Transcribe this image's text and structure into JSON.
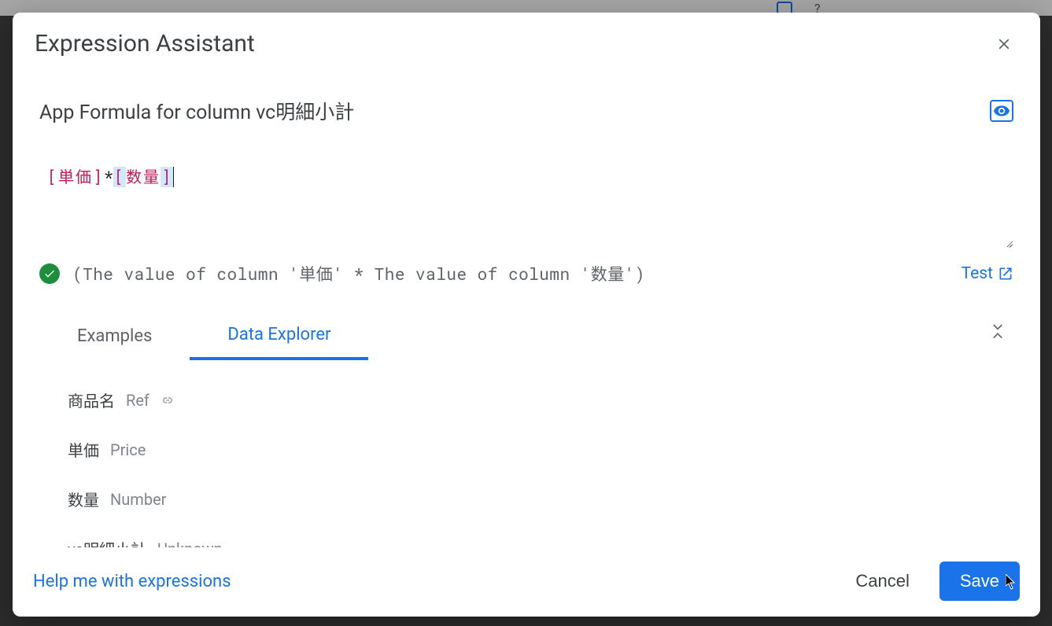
{
  "modal": {
    "title": "Expression Assistant",
    "subtitle": "App Formula for column vc明細小計"
  },
  "editor": {
    "tokens": {
      "col1_open": "[",
      "col1": "単価",
      "col1_close": "]",
      "op": "*",
      "col2_open": "[",
      "col2": "数量",
      "col2_close": "]"
    }
  },
  "validation": {
    "message": "(The value of column '単価' * The value of column '数量')"
  },
  "test": {
    "label": "Test"
  },
  "tabs": {
    "examples": "Examples",
    "data_explorer": "Data Explorer",
    "active": "data_explorer"
  },
  "explorer": {
    "items": [
      {
        "name": "商品名",
        "type": "Ref",
        "has_link": true
      },
      {
        "name": "単価",
        "type": "Price",
        "has_link": false
      },
      {
        "name": "数量",
        "type": "Number",
        "has_link": false
      },
      {
        "name": "vc明細小計",
        "type": "Unknown",
        "has_link": false
      }
    ]
  },
  "footer": {
    "help": "Help me with expressions",
    "cancel": "Cancel",
    "save": "Save"
  },
  "colors": {
    "primary": "#1a73e8",
    "success": "#1e8e3e",
    "token_column": "#c2185b"
  }
}
